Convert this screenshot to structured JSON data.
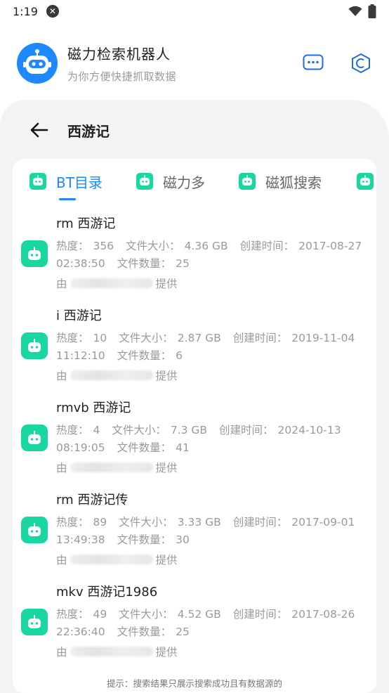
{
  "status": {
    "time": "1:19"
  },
  "app": {
    "title": "磁力检索机器人",
    "subtitle": "为你方便快捷抓取数据"
  },
  "page": {
    "title": "西游记"
  },
  "tabs": [
    {
      "label": "BT目录",
      "active": true
    },
    {
      "label": "磁力多",
      "active": false
    },
    {
      "label": "磁狐搜索",
      "active": false
    },
    {
      "label": "",
      "active": false
    }
  ],
  "labels": {
    "heat": "热度：",
    "size": "文件大小：",
    "created": "创建时间：",
    "count": "文件数量：",
    "by": "由",
    "provided": "提供"
  },
  "results": [
    {
      "title": "rm 西游记",
      "heat": "356",
      "size": "4.36 GB",
      "created": "2017-08-27 02:38:50",
      "count": "25"
    },
    {
      "title": "i 西游记",
      "heat": "10",
      "size": "2.87 GB",
      "created": "2019-11-04 11:12:10",
      "count": "6"
    },
    {
      "title": "rmvb 西游记",
      "heat": "4",
      "size": "7.3 GB",
      "created": "2024-10-13 08:19:05",
      "count": "41"
    },
    {
      "title": "rm 西游记传",
      "heat": "89",
      "size": "3.33 GB",
      "created": "2017-09-01 13:49:38",
      "count": "30"
    },
    {
      "title": "mkv 西游记1986",
      "heat": "49",
      "size": "4.52 GB",
      "created": "2017-08-26 22:36:40",
      "count": "25"
    }
  ],
  "footer": {
    "tip": "提示：搜索结果只展示搜索成功且有数据源的"
  },
  "colors": {
    "accent": "#1e88ff",
    "robot": "#1ad6a0"
  }
}
